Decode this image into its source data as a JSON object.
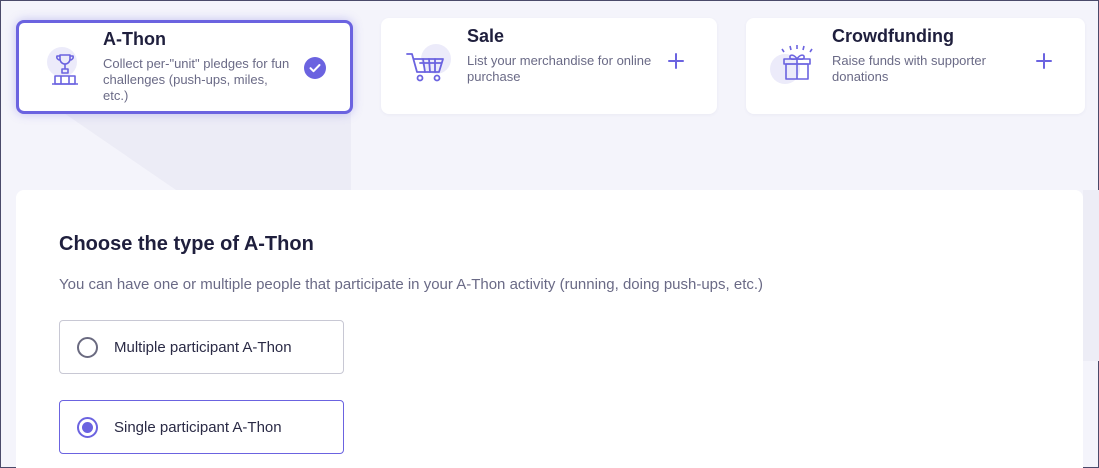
{
  "colors": {
    "accent": "#6b63e0",
    "background": "#f4f4fb",
    "card": "#ffffff",
    "title": "#1f1f3d",
    "muted": "#6a6a86"
  },
  "cards": [
    {
      "title": "A-Thon",
      "description": "Collect per-\"unit\" pledges for fun challenges (push-ups, miles, etc.)",
      "icon": "trophy-podium-icon",
      "selected": true,
      "action_icon": "check-circle-icon"
    },
    {
      "title": "Sale",
      "description": "List your merchandise for online purchase",
      "icon": "shopping-cart-icon",
      "selected": false,
      "action_icon": "plus-icon"
    },
    {
      "title": "Crowdfunding",
      "description": "Raise funds with supporter donations",
      "icon": "gift-box-icon",
      "selected": false,
      "action_icon": "plus-icon"
    }
  ],
  "panel": {
    "title": "Choose the type of A-Thon",
    "subtitle": "You can have one or multiple people that participate in your A-Thon activity (running, doing push-ups, etc.)",
    "options": [
      {
        "label": "Multiple participant A-Thon",
        "selected": false
      },
      {
        "label": "Single participant A-Thon",
        "selected": true
      }
    ]
  }
}
